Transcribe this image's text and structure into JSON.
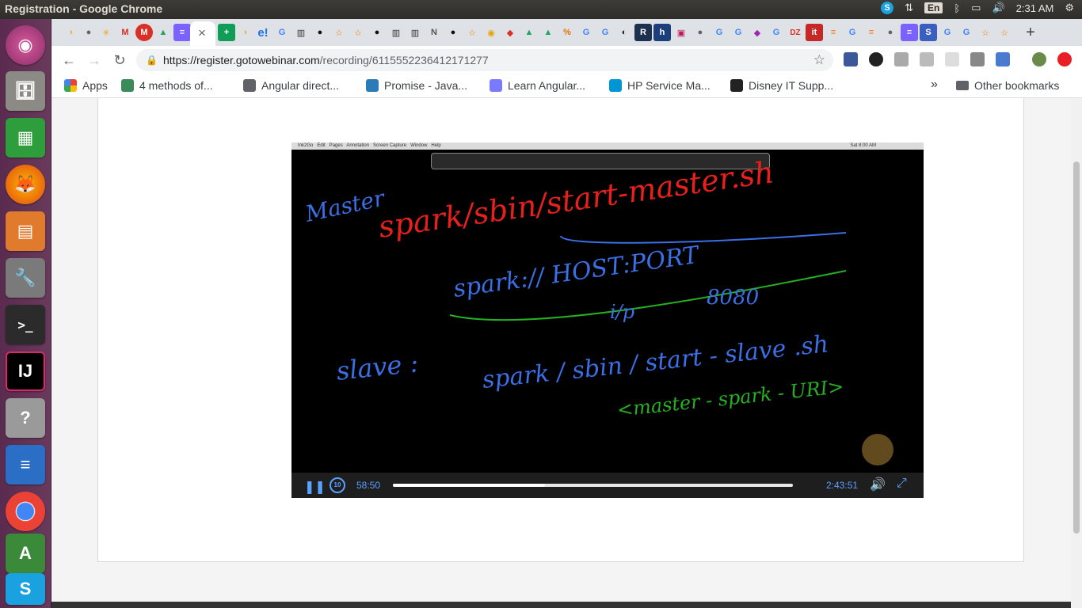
{
  "window": {
    "title": "Registration - Google Chrome"
  },
  "system_tray": {
    "lang": "En",
    "time": "2:31 AM"
  },
  "browser": {
    "url_host": "https://register.gotowebinar.com",
    "url_path": "/recording/6115552236412171277",
    "new_tab": "+",
    "active_tab_close": "×"
  },
  "bookmarks": [
    {
      "label": "Apps",
      "icon": "apps-grid-icon",
      "color": "#ea4335"
    },
    {
      "label": "4 methods of...",
      "icon": "avatar-icon",
      "color": "#3b8a5a"
    },
    {
      "label": "Angular direct...",
      "icon": "globe-icon",
      "color": "#5f6368"
    },
    {
      "label": "Promise - Java...",
      "icon": "bird-icon",
      "color": "#2b7bb9"
    },
    {
      "label": "Learn Angular...",
      "icon": "code-icon",
      "color": "#7a7aff"
    },
    {
      "label": "HP Service Ma...",
      "icon": "hp-logo-icon",
      "color": "#0096d6"
    },
    {
      "label": "Disney IT Supp...",
      "icon": "disney-icon",
      "color": "#222222"
    }
  ],
  "other_bookmarks": "Other bookmarks",
  "overflow": "»",
  "player": {
    "current_time": "58:50",
    "duration": "2:43:51",
    "progress": 0.38,
    "rewind_label": "10",
    "app_menu": "Ink2Go   Edit   Pages   Annotation   Screen Capture   Window   Help",
    "mac_status": "Sat 8:00 AM"
  },
  "whiteboard": {
    "master_label": "Master",
    "master_cmd": "spark/sbin/start-master.sh",
    "spark_uri": "spark:// HOST:PORT",
    "ip": "i/p",
    "port": "8080",
    "slave_label": "slave :",
    "slave_cmd": "spark / sbin / start - slave .sh",
    "slave_arg": "<master - spark - URI>"
  },
  "colors": {
    "accent": "#5aa0ff",
    "launcher": "#5e2e52",
    "ink_red": "#e8201c",
    "ink_blue": "#3b6fe6",
    "ink_green": "#25b023"
  }
}
